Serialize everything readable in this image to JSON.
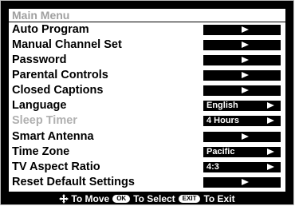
{
  "menu": {
    "title": "Main Menu",
    "items": [
      {
        "label": "Auto Program",
        "value": "",
        "arrow": "center",
        "enabled": true
      },
      {
        "label": "Manual Channel Set",
        "value": "",
        "arrow": "center",
        "enabled": true
      },
      {
        "label": "Password",
        "value": "",
        "arrow": "center",
        "enabled": true
      },
      {
        "label": "Parental Controls",
        "value": "",
        "arrow": "center",
        "enabled": true
      },
      {
        "label": "Closed Captions",
        "value": "",
        "arrow": "center",
        "enabled": true
      },
      {
        "label": "Language",
        "value": "English",
        "arrow": "right",
        "enabled": true
      },
      {
        "label": "Sleep Timer",
        "value": "4 Hours",
        "arrow": "right",
        "enabled": false
      },
      {
        "label": "Smart Antenna",
        "value": "",
        "arrow": "center",
        "enabled": true
      },
      {
        "label": "Time Zone",
        "value": "Pacific",
        "arrow": "right",
        "enabled": true
      },
      {
        "label": "TV Aspect Ratio",
        "value": "4:3",
        "arrow": "right",
        "enabled": true
      },
      {
        "label": "Reset Default Settings",
        "value": "",
        "arrow": "center",
        "enabled": true
      }
    ]
  },
  "footer": {
    "move_icon": "four-way-arrows-icon",
    "move_text": "To Move",
    "ok_key": "OK",
    "select_text": "To Select",
    "exit_key": "EXIT",
    "exit_text": "To Exit"
  },
  "colors": {
    "background": "#000000",
    "panel": "#ffffff",
    "disabled_text": "#b0b0b0"
  }
}
